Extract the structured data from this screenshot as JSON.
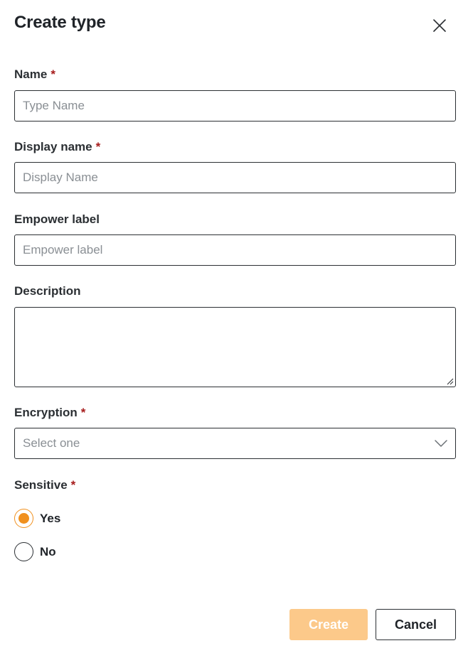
{
  "dialog": {
    "title": "Create type",
    "close_icon": "close-icon"
  },
  "form": {
    "required_marker": "*",
    "name": {
      "label": "Name",
      "required": true,
      "value": "",
      "placeholder": "Type Name"
    },
    "display_name": {
      "label": "Display name",
      "required": true,
      "value": "",
      "placeholder": "Display Name"
    },
    "empower_label": {
      "label": "Empower label",
      "required": false,
      "value": "",
      "placeholder": "Empower label"
    },
    "description": {
      "label": "Description",
      "required": false,
      "value": ""
    },
    "encryption": {
      "label": "Encryption",
      "required": true,
      "selected": "Select one",
      "icon": "chevron-down-icon"
    },
    "sensitive": {
      "label": "Sensitive",
      "required": true,
      "options": [
        {
          "label": "Yes",
          "checked": true
        },
        {
          "label": "No",
          "checked": false
        }
      ]
    }
  },
  "actions": {
    "create_label": "Create",
    "cancel_label": "Cancel",
    "create_disabled": true
  },
  "colors": {
    "accent": "#f0901e",
    "primary_disabled": "#fcc98a",
    "required": "#a61b1b",
    "border": "#2b2f33",
    "placeholder": "#8a8f94"
  }
}
